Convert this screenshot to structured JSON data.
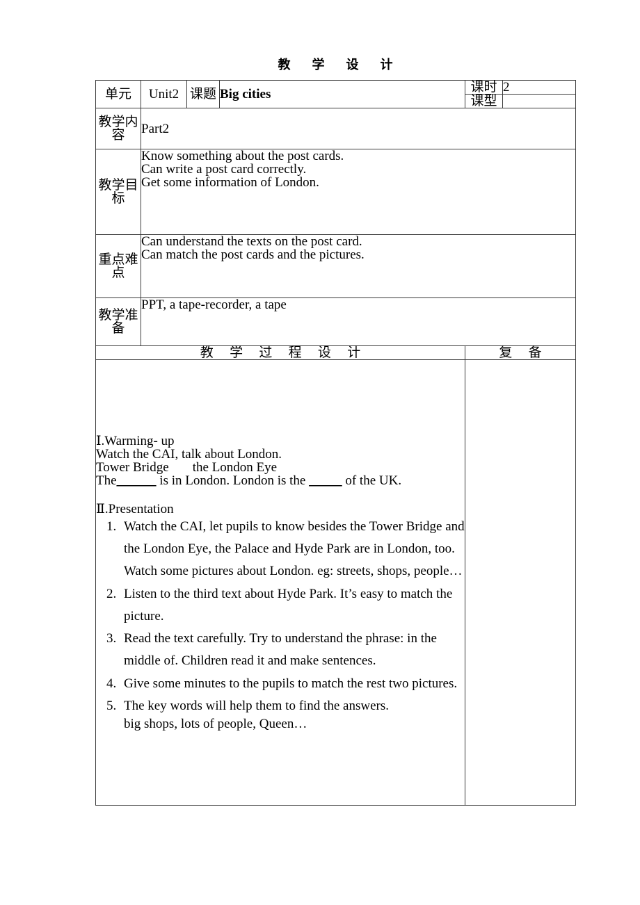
{
  "document": {
    "title": "教  学  设  计"
  },
  "info_table": {
    "unit_label": "单元",
    "unit_value": "Unit2",
    "topic_label": "课题",
    "topic_value": "Big cities",
    "period_label": "课时",
    "period_value": "2",
    "lesson_type_label": "课型",
    "lesson_type_value": "",
    "content_label": "教学内容",
    "content_value": "Part2",
    "objective_label": "教学目标",
    "objective_lines": [
      "Know something about the post cards.",
      "Can write a post card correctly.",
      "Get some information of London."
    ],
    "focus_label": "重点难点",
    "focus_lines": [
      "Can understand the texts on the post card.",
      "Can match the post cards and the pictures."
    ],
    "preparation_label": "教学准备",
    "preparation_value": "PPT, a tape-recorder, a tape"
  },
  "process": {
    "header_left": "教  学  过  程  设  计",
    "header_right": "复  备",
    "revision_notes": "",
    "section1": {
      "heading": "Ⅰ.Warming- up",
      "lines": [
        "Watch the CAI, talk about London.",
        "Tower Bridge"
      ],
      "line3_part2": "the London Eye",
      "fill_sentence": {
        "before": "The",
        "blank1": "______",
        "middle": " is in London. London is the ",
        "blank2": "_____",
        "after": " of the UK."
      }
    },
    "section2": {
      "heading": "Ⅱ.Presentation",
      "steps": [
        "Watch the CAI, let pupils to know besides the Tower Bridge and the London Eye, the Palace and Hyde Park are in London, too. Watch some pictures about London. eg: streets, shops, people…",
        "Listen to the third text about Hyde Park. It’s easy to match the picture.",
        "Read the text carefully. Try to understand the phrase: in the middle of. Children read it and make sentences.",
        "Give some minutes to the pupils to match the rest two pictures.",
        "The key words will help them to find the answers."
      ],
      "step5_sub": "big shops, lots of people, Queen…"
    }
  }
}
